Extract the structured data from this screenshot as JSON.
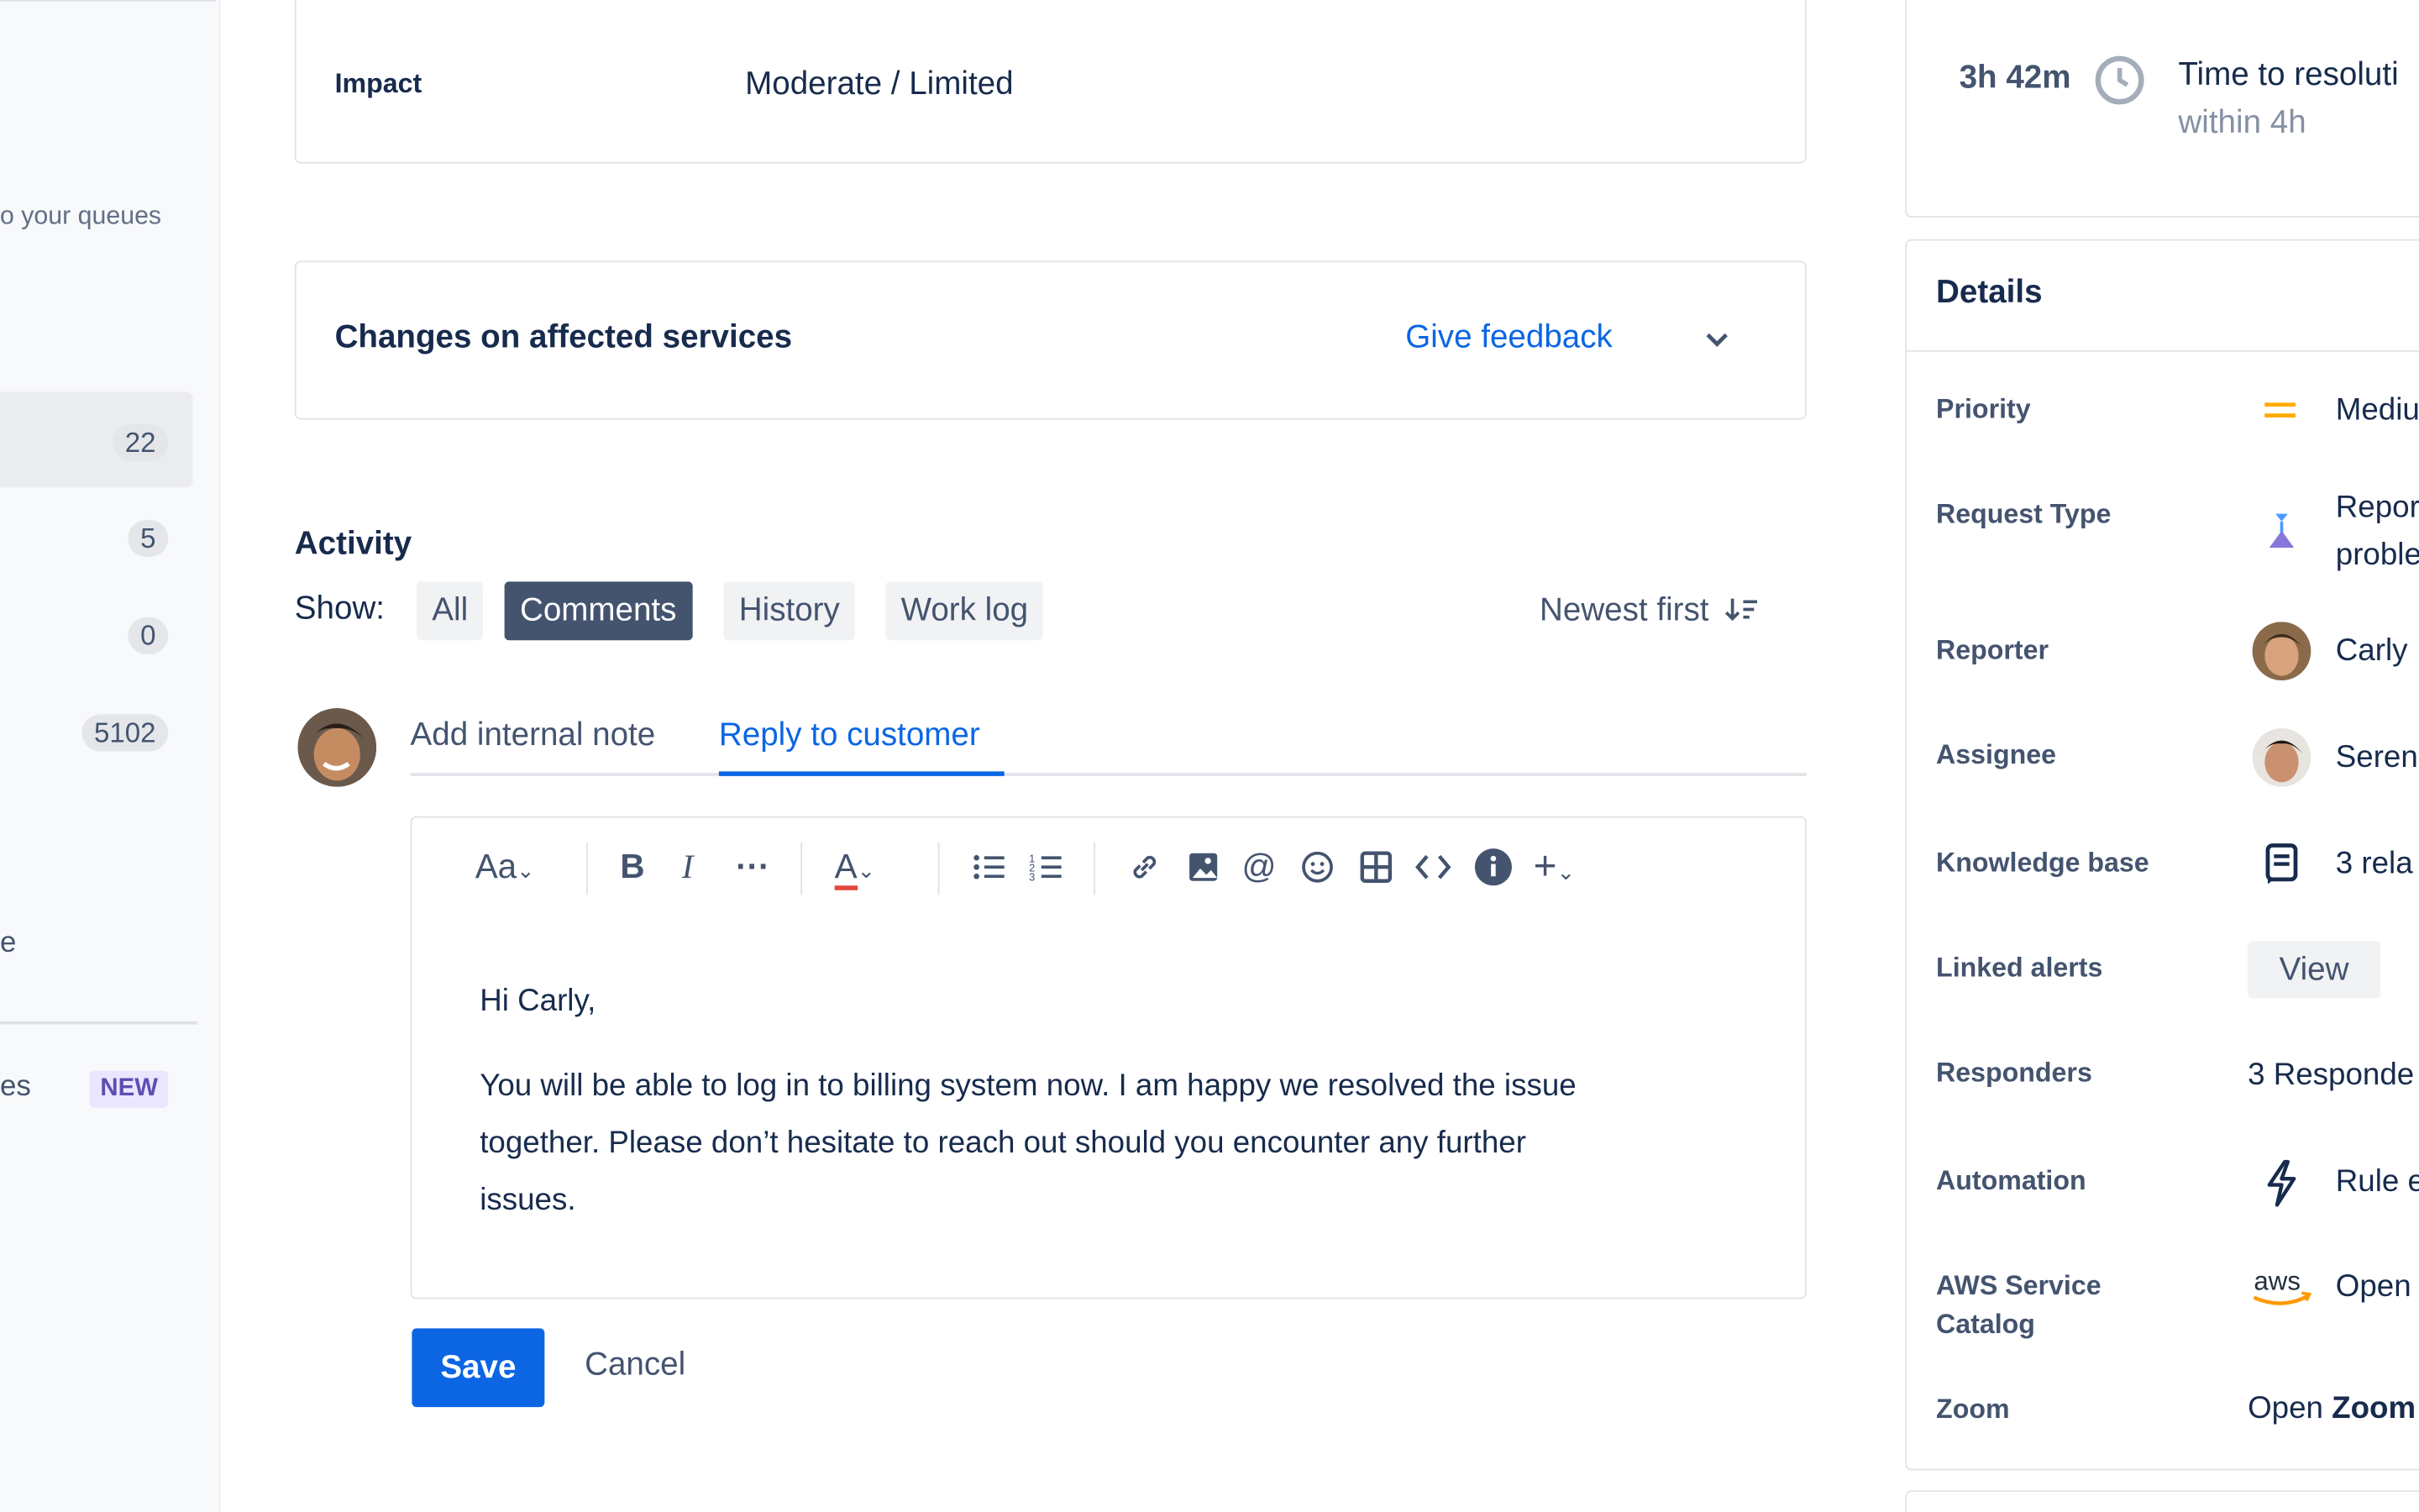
{
  "sidebar": {
    "queues_hint": "o your queues",
    "counts": [
      "22",
      "5",
      "0",
      "5102"
    ],
    "item_partial_1": "e",
    "item_partial_2": "es",
    "new_badge": "NEW"
  },
  "impact": {
    "label": "Impact",
    "value": "Moderate / Limited"
  },
  "changes": {
    "title": "Changes on affected services",
    "feedback": "Give feedback"
  },
  "activity": {
    "title": "Activity",
    "show_label": "Show:",
    "filters": [
      "All",
      "Comments",
      "History",
      "Work log"
    ],
    "selected_filter": "Comments",
    "sort": "Newest first"
  },
  "reply": {
    "tabs": [
      "Add internal note",
      "Reply to customer"
    ],
    "active_tab": "Reply to customer",
    "toolbar": {
      "text_style": "Aa"
    },
    "body": {
      "greeting": "Hi Carly,",
      "line1": "You will be able to log in to billing system now. I am happy we resolved the issue",
      "line2": "together. Please don’t hesitate to reach out should you encounter any further",
      "line3": "issues."
    },
    "save": "Save",
    "cancel": "Cancel"
  },
  "sla": {
    "time": "3h 42m",
    "title": "Time to resoluti",
    "target": "within 4h"
  },
  "details": {
    "title": "Details",
    "rows": [
      {
        "label": "Priority",
        "value": "Mediu",
        "icon": "priority-medium-icon"
      },
      {
        "label": "Request Type",
        "value": "Repor",
        "value2": "proble",
        "icon": "request-type-icon"
      },
      {
        "label": "Reporter",
        "value": "Carly",
        "icon": "avatar"
      },
      {
        "label": "Assignee",
        "value": "Seren",
        "icon": "avatar"
      },
      {
        "label": "Knowledge base",
        "value": "3 rela",
        "icon": "knowledge-base-icon"
      },
      {
        "label": "Linked alerts",
        "value": "View"
      },
      {
        "label": "Responders",
        "value": "3 Responde"
      },
      {
        "label": "Automation",
        "value": "Rule e",
        "icon": "lightning-icon"
      },
      {
        "label": "AWS Service",
        "label2": "Catalog",
        "value": "Open",
        "icon": "aws-logo"
      },
      {
        "label": "Zoom",
        "value": "Open ",
        "value_bold": "Zoom"
      }
    ]
  },
  "colors": {
    "accent": "#0c66e4",
    "selected_filter_bg": "#44546f",
    "priority_medium": "#ffab00",
    "new_badge": "#5e4db2"
  }
}
